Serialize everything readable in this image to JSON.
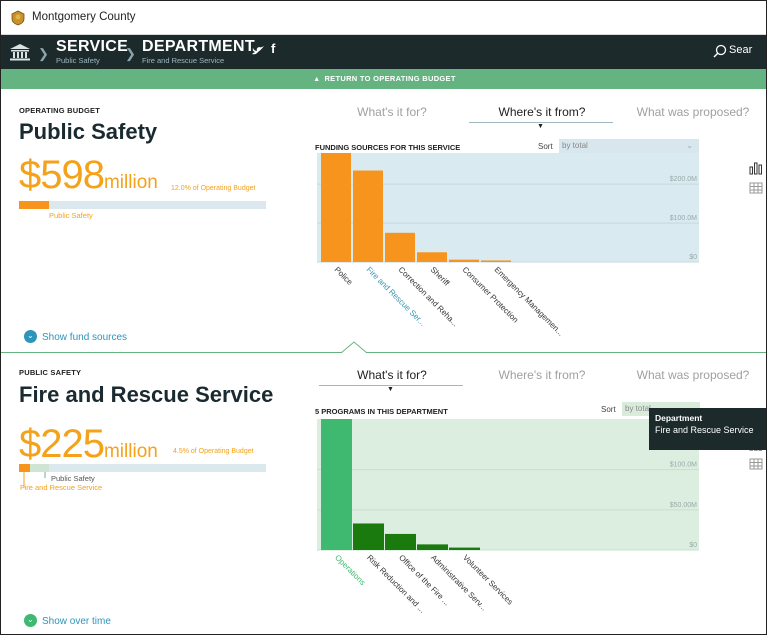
{
  "window": {
    "title": "Montgomery County"
  },
  "nav": {
    "service_label": "SERVICE",
    "service_sub": "Public Safety",
    "department_label": "DEPARTMENT",
    "department_sub": "Fire and Rescue Service",
    "search_label": "Sear"
  },
  "return_bar": {
    "label": "RETURN TO OPERATING BUDGET"
  },
  "section1": {
    "eyebrow": "OPERATING BUDGET",
    "title": "Public Safety",
    "amount_number": "$598",
    "amount_unit": "million",
    "pct_text": "12.0% of Operating Budget",
    "bar_fraction": 0.12,
    "bar_label": "Public Safety",
    "tabs": [
      "What's it for?",
      "Where's it from?",
      "What was proposed?"
    ],
    "active_tab": 1,
    "chart_heading": "FUNDING SOURCES FOR THIS SERVICE",
    "sort_label": "Sort",
    "sort_value": "by total",
    "show_link": "Show fund sources"
  },
  "section2": {
    "eyebrow": "PUBLIC SAFETY",
    "title": "Fire and Rescue Service",
    "amount_number": "$225",
    "amount_unit": "million",
    "pct_text": "4.5% of Operating Budget",
    "bar_fraction": 0.045,
    "bar_label_1": "Public Safety",
    "bar_label_2": "Fire and Rescue Service",
    "tabs": [
      "What's it for?",
      "Where's it from?",
      "What was proposed?"
    ],
    "active_tab": 0,
    "chart_heading": "5 PROGRAMS IN THIS DEPARTMENT",
    "sort_label": "Sort",
    "sort_value": "by total",
    "show_link": "Show over time",
    "tooltip_title": "Department",
    "tooltip_value": "Fire and Rescue Service"
  },
  "colors": {
    "orange": "#f7941d",
    "green_bright": "#3fb970",
    "green_dark": "#1b7a0d",
    "nav_dark": "#1d2a2c",
    "return_green": "#66b382",
    "link_blue": "#2e94b9",
    "chart_bg_blue": "#d9eaf0",
    "chart_bg_green": "#dceee0"
  },
  "chart_data": [
    {
      "type": "bar",
      "title": "FUNDING SOURCES FOR THIS SERVICE",
      "categories": [
        "Police",
        "Fire and Rescue Ser...",
        "Correction and Reha...",
        "Sheriff",
        "Consumer Protection",
        "Emergency Managemen..."
      ],
      "values": [
        280,
        235,
        75,
        25,
        6,
        4
      ],
      "highlight_index": 1,
      "ytick_labels": [
        "$0",
        "$100.0M",
        "$200.0M"
      ],
      "yticks": [
        0,
        100,
        200
      ],
      "ylim": [
        0,
        280
      ],
      "grid": true
    },
    {
      "type": "bar",
      "title": "5 PROGRAMS IN THIS DEPARTMENT",
      "categories": [
        "Operations",
        "Risk Reduction and ...",
        "Office of the Fire ...",
        "Administrative Serv...",
        "Volunteer Services"
      ],
      "values": [
        163,
        33,
        20,
        7,
        3
      ],
      "highlight_index": 0,
      "ytick_labels": [
        "$0",
        "$50.00M",
        "$100.0M"
      ],
      "yticks": [
        0,
        50,
        100
      ],
      "ylim": [
        0,
        163
      ],
      "grid": true
    }
  ]
}
